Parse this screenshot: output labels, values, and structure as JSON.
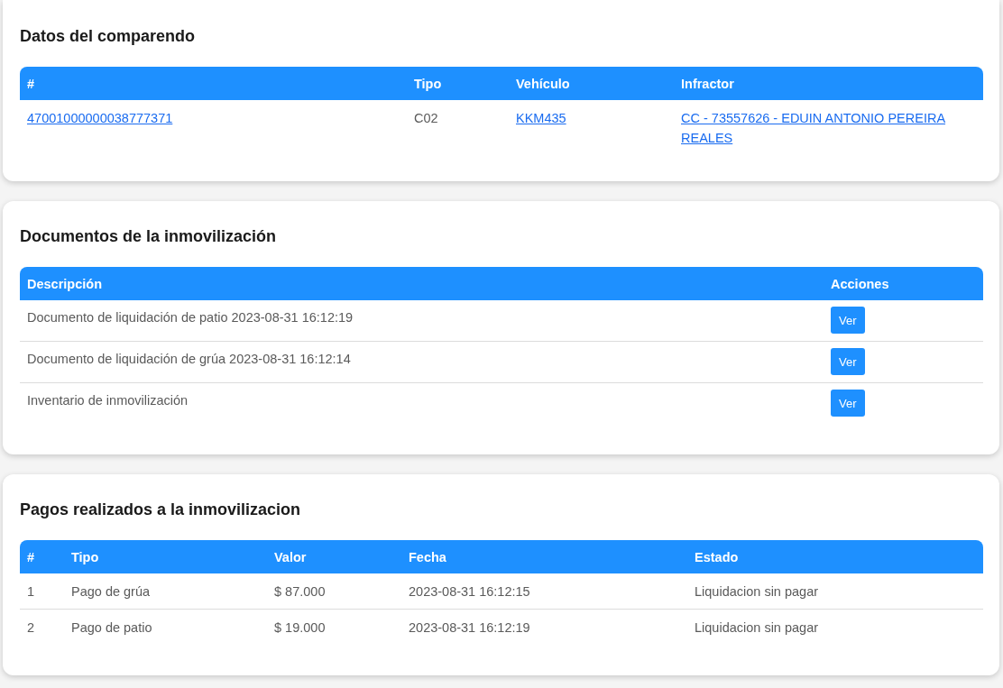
{
  "sections": [
    {
      "title": "Datos del comparendo",
      "kind": "plain",
      "columns": [
        "#",
        "Tipo",
        "Vehículo",
        "Infractor"
      ],
      "rows": [
        [
          {
            "text": "47001000000038777371",
            "kind": "link"
          },
          {
            "text": "C02",
            "kind": "text"
          },
          {
            "text": "KKM435",
            "kind": "link"
          },
          {
            "text": "CC - 73557626 - EDUIN ANTONIO PEREIRA REALES",
            "kind": "link"
          }
        ]
      ]
    },
    {
      "title": "Documentos de la inmovilización",
      "kind": "documents",
      "columns": [
        "Descripción",
        "Acciones"
      ],
      "rows": [
        [
          {
            "text": "Documento de liquidación de patio 2023-08-31 16:12:19",
            "kind": "text"
          },
          {
            "text": "Ver",
            "kind": "button"
          }
        ],
        [
          {
            "text": "Documento de liquidación de grúa 2023-08-31 16:12:14",
            "kind": "text"
          },
          {
            "text": "Ver",
            "kind": "button"
          }
        ],
        [
          {
            "text": "Inventario de inmovilización",
            "kind": "text"
          },
          {
            "text": "Ver",
            "kind": "button"
          }
        ]
      ]
    },
    {
      "title": "Pagos realizados a la inmovilizacion",
      "kind": "payments",
      "columns": [
        "#",
        "Tipo",
        "Valor",
        "Fecha",
        "Estado"
      ],
      "rows": [
        [
          {
            "text": "1",
            "kind": "text"
          },
          {
            "text": "Pago de grúa",
            "kind": "text"
          },
          {
            "text": "$ 87.000",
            "kind": "text"
          },
          {
            "text": "2023-08-31 16:12:15",
            "kind": "text"
          },
          {
            "text": "Liquidacion sin pagar",
            "kind": "text"
          }
        ],
        [
          {
            "text": "2",
            "kind": "text"
          },
          {
            "text": "Pago de patio",
            "kind": "text"
          },
          {
            "text": "$ 19.000",
            "kind": "text"
          },
          {
            "text": "2023-08-31 16:12:19",
            "kind": "text"
          },
          {
            "text": "Liquidacion sin pagar",
            "kind": "text"
          }
        ]
      ]
    }
  ]
}
